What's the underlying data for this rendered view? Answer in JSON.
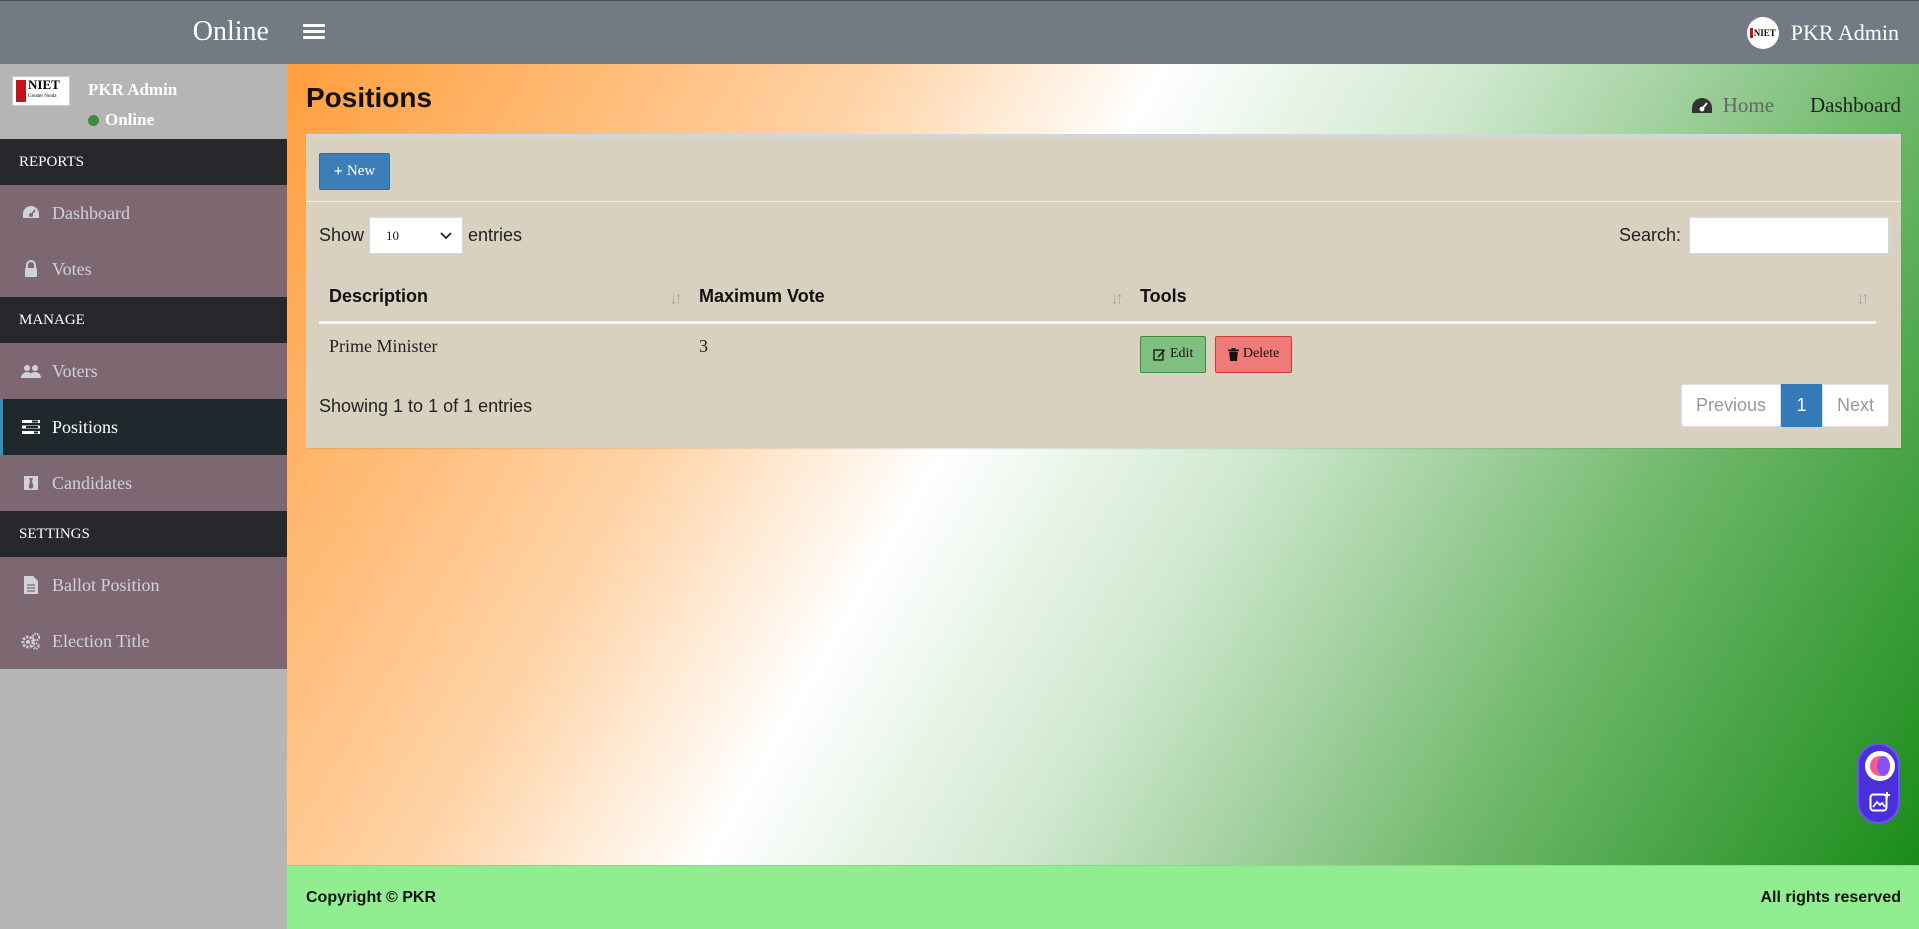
{
  "header": {
    "brand": "Online",
    "user_name": "PKR Admin"
  },
  "sidebar": {
    "user_name": "PKR Admin",
    "status": "Online",
    "logo_text": "NIET",
    "logo_subtext": "Greater Noida",
    "sections": {
      "reports": "REPORTS",
      "manage": "MANAGE",
      "settings": "SETTINGS"
    },
    "items": {
      "dashboard": "Dashboard",
      "votes": "Votes",
      "voters": "Voters",
      "positions": "Positions",
      "candidates": "Candidates",
      "ballot_position": "Ballot Position",
      "election_title": "Election Title"
    }
  },
  "page": {
    "title": "Positions",
    "breadcrumb_home": "Home",
    "breadcrumb_current": "Dashboard"
  },
  "toolbar": {
    "new_label": "New"
  },
  "table_controls": {
    "show_label": "Show",
    "entries_value": "10",
    "entries_label": "entries",
    "search_label": "Search:"
  },
  "table": {
    "headers": [
      "Description",
      "Maximum Vote",
      "Tools"
    ],
    "rows": [
      {
        "description": "Prime Minister",
        "max_vote": "3",
        "edit_label": "Edit",
        "delete_label": "Delete"
      }
    ],
    "info": "Showing 1 to 1 of 1 entries"
  },
  "pagination": {
    "previous": "Previous",
    "current": "1",
    "next": "Next"
  },
  "footer": {
    "left": "Copyright © PKR",
    "right": "All rights reserved"
  },
  "colors": {
    "topbar": "#727a84",
    "sidebar_item": "#7d6872",
    "sidebar_header": "#26282c",
    "primary": "#3c7fb8",
    "footer": "#90ee90"
  }
}
